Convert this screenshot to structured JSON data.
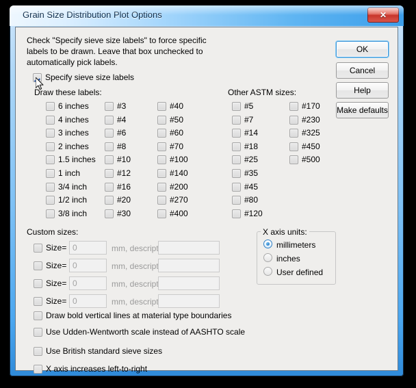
{
  "window": {
    "title": "Grain Size Distribution Plot Options",
    "close_label": "✕"
  },
  "instructions": {
    "line1": "Check \"Specify sieve size labels\" to force specific",
    "line2": "labels to be drawn. Leave that box unchecked to",
    "line3": "automatically pick labels."
  },
  "specify": {
    "label": "Specify sieve size labels",
    "checked": true
  },
  "headings": {
    "draw_these_labels": "Draw these labels:",
    "other_astm_sizes": "Other ASTM sizes:",
    "custom_sizes": "Custom sizes:"
  },
  "sieve_columns": [
    {
      "items": [
        {
          "label": "6 inches",
          "checked": false
        },
        {
          "label": "4 inches",
          "checked": false
        },
        {
          "label": "3 inches",
          "checked": false
        },
        {
          "label": "2 inches",
          "checked": false
        },
        {
          "label": "1.5 inches",
          "checked": false
        },
        {
          "label": "1 inch",
          "checked": false
        },
        {
          "label": "3/4 inch",
          "checked": false
        },
        {
          "label": "1/2 inch",
          "checked": false
        },
        {
          "label": "3/8 inch",
          "checked": false
        }
      ]
    },
    {
      "items": [
        {
          "label": "#3",
          "checked": false
        },
        {
          "label": "#4",
          "checked": false
        },
        {
          "label": "#6",
          "checked": false
        },
        {
          "label": "#8",
          "checked": false
        },
        {
          "label": "#10",
          "checked": false
        },
        {
          "label": "#12",
          "checked": false
        },
        {
          "label": "#16",
          "checked": false
        },
        {
          "label": "#20",
          "checked": false
        },
        {
          "label": "#30",
          "checked": false
        }
      ]
    },
    {
      "items": [
        {
          "label": "#40",
          "checked": false
        },
        {
          "label": "#50",
          "checked": false
        },
        {
          "label": "#60",
          "checked": false
        },
        {
          "label": "#70",
          "checked": false
        },
        {
          "label": "#100",
          "checked": false
        },
        {
          "label": "#140",
          "checked": false
        },
        {
          "label": "#200",
          "checked": false
        },
        {
          "label": "#270",
          "checked": false
        },
        {
          "label": "#400",
          "checked": false
        }
      ]
    }
  ],
  "astm_columns": [
    {
      "items": [
        {
          "label": "#5",
          "checked": false
        },
        {
          "label": "#7",
          "checked": false
        },
        {
          "label": "#14",
          "checked": false
        },
        {
          "label": "#18",
          "checked": false
        },
        {
          "label": "#25",
          "checked": false
        },
        {
          "label": "#35",
          "checked": false
        },
        {
          "label": "#45",
          "checked": false
        },
        {
          "label": "#80",
          "checked": false
        },
        {
          "label": "#120",
          "checked": false
        }
      ]
    },
    {
      "items": [
        {
          "label": "#170",
          "checked": false
        },
        {
          "label": "#230",
          "checked": false
        },
        {
          "label": "#325",
          "checked": false
        },
        {
          "label": "#450",
          "checked": false
        },
        {
          "label": "#500",
          "checked": false
        }
      ]
    }
  ],
  "custom_rows": [
    {
      "checked": false,
      "label": "Size=",
      "value": "0",
      "unit_label": "mm, description:",
      "description": ""
    },
    {
      "checked": false,
      "label": "Size=",
      "value": "0",
      "unit_label": "mm, description:",
      "description": ""
    },
    {
      "checked": false,
      "label": "Size=",
      "value": "0",
      "unit_label": "mm, description:",
      "description": ""
    },
    {
      "checked": false,
      "label": "Size=",
      "value": "0",
      "unit_label": "mm, description:",
      "description": ""
    }
  ],
  "x_axis_units": {
    "title": "X axis units:",
    "options": [
      {
        "label": "millimeters",
        "selected": true
      },
      {
        "label": "inches",
        "selected": false
      },
      {
        "label": "User defined",
        "selected": false
      }
    ]
  },
  "bottom_options": [
    {
      "label": "Draw bold vertical lines at material type boundaries",
      "checked": false
    },
    {
      "label": "Use Udden-Wentworth scale instead of AASHTO scale",
      "checked": false
    },
    {
      "label": "Use British standard sieve sizes",
      "checked": false
    },
    {
      "label": "X axis increases left-to-right",
      "checked": false
    }
  ],
  "buttons": [
    {
      "label": "OK",
      "focused": true
    },
    {
      "label": "Cancel",
      "focused": false
    },
    {
      "label": "Help",
      "focused": false
    },
    {
      "label": "Make defaults",
      "focused": false
    }
  ]
}
